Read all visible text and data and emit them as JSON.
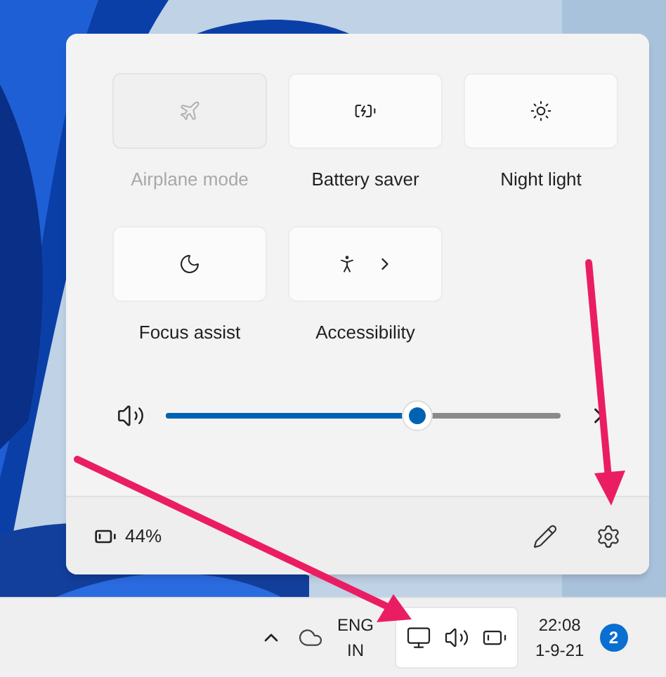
{
  "quick_settings": {
    "tiles": [
      {
        "label": "Airplane mode",
        "disabled": true,
        "submenu": false
      },
      {
        "label": "Battery saver",
        "disabled": false,
        "submenu": false
      },
      {
        "label": "Night light",
        "disabled": false,
        "submenu": false
      },
      {
        "label": "Focus assist",
        "disabled": false,
        "submenu": false
      },
      {
        "label": "Accessibility",
        "disabled": false,
        "submenu": true
      }
    ],
    "volume": {
      "level": 0.65
    },
    "battery": "44%"
  },
  "taskbar": {
    "language": [
      "ENG",
      "IN"
    ],
    "tray": {
      "selected": true
    },
    "time": "22:08",
    "date": "1-9-21",
    "notifications": "2"
  }
}
